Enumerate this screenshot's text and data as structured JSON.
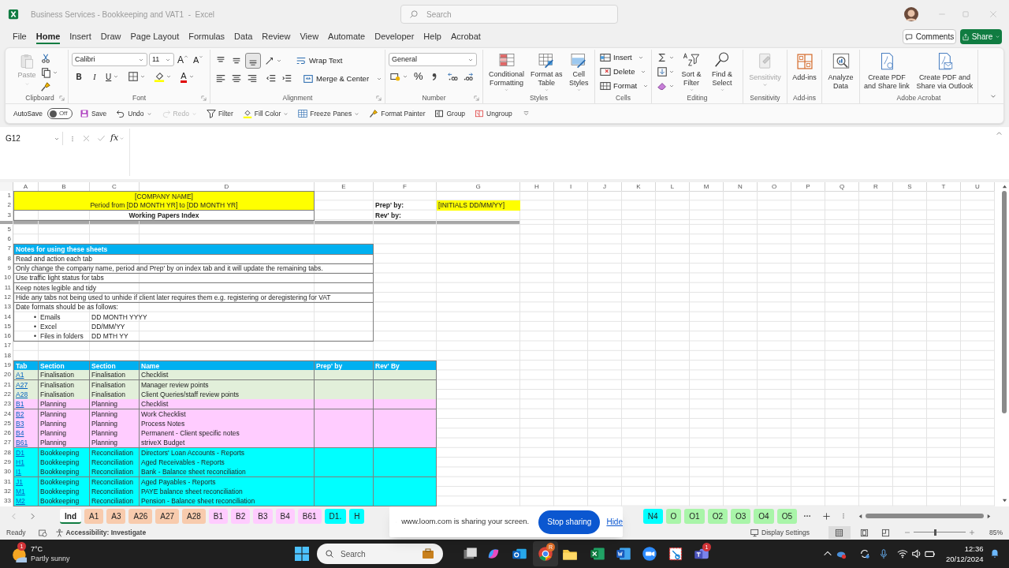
{
  "window": {
    "title": "Business Services - Bookkeeping and VAT1  -  Excel",
    "search_placeholder": "Search"
  },
  "menu_tabs": [
    {
      "label": "File",
      "selected": false
    },
    {
      "label": "Home",
      "selected": true
    },
    {
      "label": "Insert",
      "selected": false
    },
    {
      "label": "Draw",
      "selected": false
    },
    {
      "label": "Page Layout",
      "selected": false
    },
    {
      "label": "Formulas",
      "selected": false
    },
    {
      "label": "Data",
      "selected": false
    },
    {
      "label": "Review",
      "selected": false
    },
    {
      "label": "View",
      "selected": false
    },
    {
      "label": "Automate",
      "selected": false
    },
    {
      "label": "Developer",
      "selected": false
    },
    {
      "label": "Help",
      "selected": false
    },
    {
      "label": "Acrobat",
      "selected": false
    }
  ],
  "header_buttons": {
    "comments": "Comments",
    "share": "Share"
  },
  "ribbon": {
    "groups": [
      {
        "kind": "clipboard",
        "label": "Clipboard",
        "paste": "Paste"
      },
      {
        "kind": "font",
        "label": "Font",
        "font_name": "Calibri",
        "font_size": "11",
        "grow": "A",
        "shrink": "A",
        "bold": "B",
        "italic": "I",
        "underline": "U",
        "font_color": "A"
      },
      {
        "kind": "alignment",
        "label": "Alignment",
        "wrap": "Wrap Text",
        "merge": "Merge & Center"
      },
      {
        "kind": "number",
        "label": "Number",
        "format": "General",
        "percent": "%"
      },
      {
        "kind": "styles",
        "label": "Styles",
        "buttons": [
          "Conditional Formatting",
          "Format as Table",
          "Cell Styles"
        ]
      },
      {
        "kind": "cells",
        "label": "Cells",
        "buttons": [
          "Insert",
          "Delete",
          "Format"
        ]
      },
      {
        "kind": "editing",
        "label": "Editing",
        "buttons": [
          "Sort & Filter",
          "Find & Select"
        ]
      },
      {
        "kind": "sensitivity",
        "label": "Sensitivity",
        "button": "Sensitivity"
      },
      {
        "kind": "addins",
        "label": "Add-ins",
        "button": "Add-ins"
      },
      {
        "kind": "analyze",
        "button": "Analyze Data"
      },
      {
        "kind": "acrobat",
        "label": "Adobe Acrobat",
        "buttons": [
          "Create PDF and Share link",
          "Create PDF and Share via Outlook"
        ]
      }
    ]
  },
  "quick_access": {
    "autosave": {
      "label": "AutoSave",
      "on": false,
      "state_text": "Off"
    },
    "items": [
      {
        "label": "Save",
        "disabled": false,
        "dropdown": false
      },
      {
        "label": "Undo",
        "disabled": false,
        "dropdown": true
      },
      {
        "label": "Redo",
        "disabled": true,
        "dropdown": true
      },
      {
        "label": "Filter",
        "disabled": false,
        "dropdown": false
      },
      {
        "label": "Fill Color",
        "disabled": false,
        "dropdown": true
      },
      {
        "label": "Freeze Panes",
        "disabled": false,
        "dropdown": true
      },
      {
        "label": "Format Painter",
        "disabled": false,
        "dropdown": false
      },
      {
        "label": "Group",
        "disabled": false,
        "dropdown": false
      },
      {
        "label": "Ungroup",
        "disabled": false,
        "dropdown": false
      }
    ]
  },
  "formula_bar": {
    "name_box": "G12",
    "fx": "fx"
  },
  "sheet": {
    "columns": [
      "A",
      "B",
      "C",
      "D",
      "E",
      "F",
      "G",
      "H",
      "I",
      "J",
      "K",
      "L",
      "M",
      "N",
      "O",
      "P",
      "Q",
      "R",
      "S",
      "T",
      "U"
    ],
    "row_numbers": [
      "1",
      "2",
      "3",
      "5",
      "6",
      "7",
      "8",
      "9",
      "10",
      "11",
      "12",
      "13",
      "14",
      "15",
      "16",
      "17",
      "18",
      "19",
      "20",
      "21",
      "22",
      "23",
      "24",
      "25",
      "26",
      "27",
      "28",
      "29",
      "30",
      "31",
      "32",
      "33"
    ],
    "header_block": {
      "company_name": "[COMPANY NAME]",
      "period": "Period from [DD MONTH YR] to [DD MONTH YR]",
      "title": "Working Papers Index"
    },
    "sign_off": {
      "prepared_label": "Prep' by:",
      "prepared_value": "[INITIALS DD/MM/YY]",
      "reviewed_label": "Rev' by:"
    },
    "notes": {
      "title": "Notes for using these sheets",
      "lines": [
        "Read and action each tab",
        "Only change the company name, period and Prep' by on index tab and it will update the remaining tabs.",
        "Use traffic light status for tabs",
        "Keep notes legible and tidy",
        "Hide any tabs not being used to unhide if client later requires them e.g. registering or deregistering for VAT"
      ],
      "date_formats_intro": "Date formats should be as follows:",
      "date_formats": [
        {
          "bullet": "•",
          "label": "Emails",
          "format": "DD MONTH YYYY"
        },
        {
          "bullet": "•",
          "label": "Excel",
          "format": "DD/MM/YY"
        },
        {
          "bullet": "•",
          "label": "Files in folders",
          "format": "DD MTH YY"
        }
      ]
    },
    "index_table": {
      "columns": [
        "Tab",
        "Section",
        "Section",
        "Name",
        "Prep' by",
        "Rev' By"
      ],
      "rows": [
        {
          "tab": "A1",
          "section": "Finalisation",
          "subsection": "Finalisation",
          "name": "Checklist",
          "color": "#e2efda"
        },
        {
          "tab": "A27",
          "section": "Finalisation",
          "subsection": "Finalisation",
          "name": "Manager review points",
          "color": "#e2efda"
        },
        {
          "tab": "A28",
          "section": "Finalisation",
          "subsection": "Finalisation",
          "name": "Client Queries/staff review points",
          "color": "#e2efda"
        },
        {
          "tab": "B1",
          "section": "Planning",
          "subsection": "Planning",
          "name": "Checklist",
          "color": "#ffccff"
        },
        {
          "tab": "B2",
          "section": "Planning",
          "subsection": "Planning",
          "name": "Work Checklist",
          "color": "#ffccff"
        },
        {
          "tab": "B3",
          "section": "Planning",
          "subsection": "Planning",
          "name": "Process Notes",
          "color": "#ffccff"
        },
        {
          "tab": "B4",
          "section": "Planning",
          "subsection": "Planning",
          "name": "Permanent - Client specific notes",
          "color": "#ffccff"
        },
        {
          "tab": "B61",
          "section": "Planning",
          "subsection": "Planning",
          "name": "striveX Budget",
          "color": "#ffccff"
        },
        {
          "tab": "D1",
          "section": "Bookkeeping",
          "subsection": "Reconciliation",
          "name": "Directors' Loan Accounts - Reports",
          "color": "#00ffff"
        },
        {
          "tab": "H1",
          "section": "Bookkeeping",
          "subsection": "Reconciliation",
          "name": "Aged Receivables - Reports",
          "color": "#00ffff"
        },
        {
          "tab": "I1",
          "section": "Bookkeeping",
          "subsection": "Reconciliation",
          "name": "Bank - Balance sheet reconciliation",
          "color": "#00ffff"
        },
        {
          "tab": "J1",
          "section": "Bookkeeping",
          "subsection": "Reconciliation",
          "name": "Aged Payables - Reports",
          "color": "#00ffff"
        },
        {
          "tab": "M1",
          "section": "Bookkeeping",
          "subsection": "Reconciliation",
          "name": "PAYE balance sheet reconciliation",
          "color": "#00ffff"
        },
        {
          "tab": "M2",
          "section": "Bookkeeping",
          "subsection": "Reconciliation",
          "name": "Pension - Balance sheet reconciliation",
          "color": "#00ffff"
        }
      ]
    }
  },
  "sheet_tabs": {
    "left": [
      {
        "label": "Ind",
        "selected": true
      },
      {
        "label": "A1",
        "selected": false,
        "color": "#f8cbad"
      },
      {
        "label": "A3",
        "selected": false,
        "color": "#f8cbad"
      },
      {
        "label": "A26",
        "selected": false,
        "color": "#f8cbad"
      },
      {
        "label": "A27",
        "selected": false,
        "color": "#f8cbad"
      },
      {
        "label": "A28",
        "selected": false,
        "color": "#f8cbad"
      },
      {
        "label": "B1",
        "selected": false,
        "color": "#ffccff"
      },
      {
        "label": "B2",
        "selected": false,
        "color": "#ffccff"
      },
      {
        "label": "B3",
        "selected": false,
        "color": "#ffccff"
      },
      {
        "label": "B4",
        "selected": false,
        "color": "#ffccff"
      },
      {
        "label": "B61",
        "selected": false,
        "color": "#ffccff"
      },
      {
        "label": "D1.",
        "selected": false,
        "color": "#00ffff"
      },
      {
        "label": "H",
        "selected": false,
        "color": "#00ffff"
      }
    ],
    "right": [
      {
        "label": "N4",
        "selected": false,
        "color": "#00ffff"
      },
      {
        "label": "O",
        "selected": false,
        "color": "#a9f5a9"
      },
      {
        "label": "O1",
        "selected": false,
        "color": "#a9f5a9"
      },
      {
        "label": "O2",
        "selected": false,
        "color": "#a9f5a9"
      },
      {
        "label": "O3",
        "selected": false,
        "color": "#a9f5a9"
      },
      {
        "label": "O4",
        "selected": false,
        "color": "#a9f5a9"
      },
      {
        "label": "O5",
        "selected": false,
        "color": "#a9f5a9"
      }
    ]
  },
  "share_banner": {
    "message": "www.loom.com is sharing your screen.",
    "stop_button": "Stop sharing",
    "hide_link": "Hide"
  },
  "status_bar": {
    "ready": "Ready",
    "accessibility": "Accessibility: Investigate",
    "display_settings": "Display Settings",
    "zoom": {
      "level": 0.42
    },
    "zoom_text": "85%"
  },
  "taskbar": {
    "weather": {
      "badge": "1",
      "temperature": "7°C",
      "condition": "Partly sunny"
    },
    "search_placeholder": "Search",
    "chrome_badge": "R",
    "teams_badge": "1",
    "time": "12:36",
    "date": "20/12/2024"
  }
}
